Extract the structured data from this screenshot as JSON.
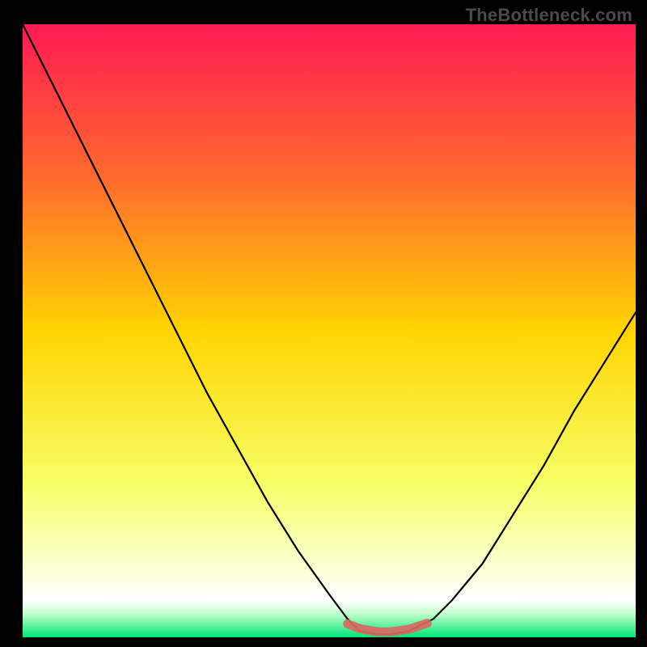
{
  "watermark": "TheBottleneck.com",
  "chart_data": {
    "type": "line",
    "title": "",
    "xlabel": "",
    "ylabel": "",
    "xlim": [
      0,
      100
    ],
    "ylim": [
      0,
      100
    ],
    "background_gradient": {
      "stops": [
        {
          "y": 0,
          "color": "#ff1a52"
        },
        {
          "y": 25,
          "color": "#ff6a2e"
        },
        {
          "y": 50,
          "color": "#ffd400"
        },
        {
          "y": 75,
          "color": "#f6ff66"
        },
        {
          "y": 95,
          "color": "#ffffff"
        },
        {
          "y": 100,
          "color": "#00e676"
        }
      ]
    },
    "series": [
      {
        "name": "bottleneck-curve",
        "color": "#000000",
        "x": [
          0,
          5,
          10,
          15,
          20,
          25,
          30,
          35,
          40,
          45,
          50,
          53,
          55,
          58,
          60,
          63,
          67,
          70,
          75,
          80,
          85,
          90,
          95,
          100
        ],
        "y": [
          100,
          90,
          80,
          70,
          60,
          50,
          40,
          31,
          22,
          14,
          7,
          3,
          1,
          0.5,
          0.5,
          1,
          3,
          6,
          12,
          20,
          28,
          37,
          45,
          53
        ]
      },
      {
        "name": "optimal-band-highlight",
        "color": "#d8695f",
        "note": "thick segment marking the flat bottom of the curve",
        "x": [
          53,
          55,
          58,
          60,
          63,
          66
        ],
        "y": [
          2.2,
          1.4,
          0.9,
          0.9,
          1.3,
          2.3
        ]
      }
    ]
  },
  "colors": {
    "page_bg": "#000000",
    "curve": "#000000",
    "highlight": "#d8695f",
    "watermark": "#4a4a4a"
  }
}
